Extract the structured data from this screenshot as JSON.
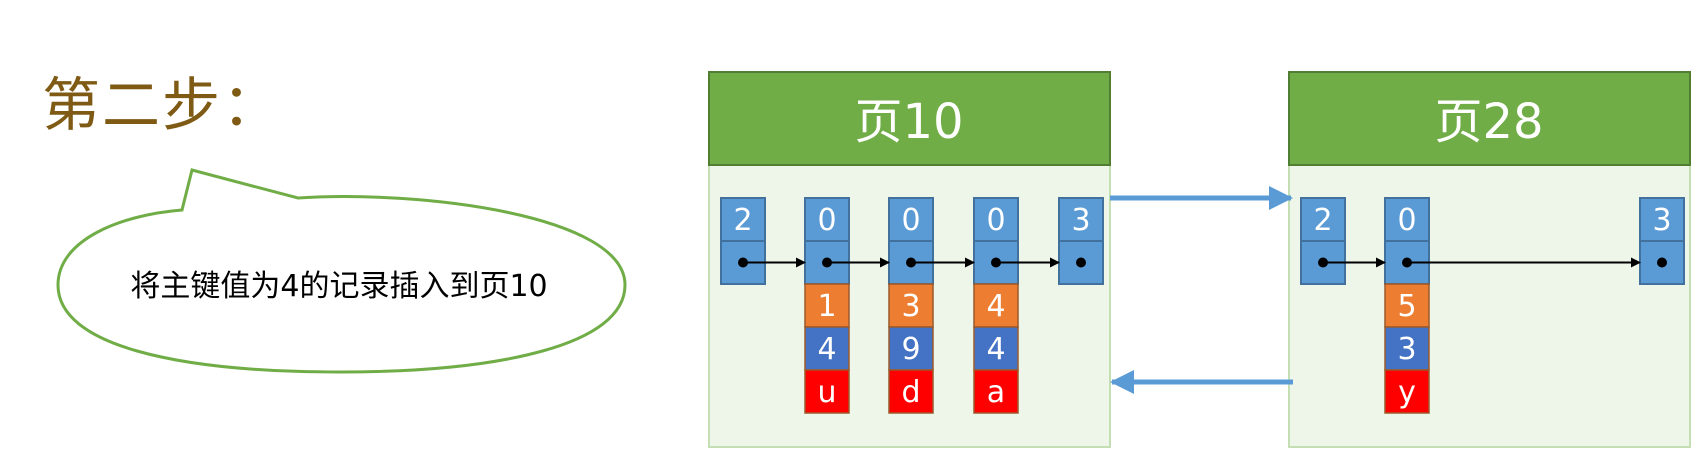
{
  "step_title": "第二步：",
  "callout": {
    "text": "将主键值为4的记录插入到页10"
  },
  "colors": {
    "page_header": "#70ad47",
    "page_header_border": "#507e32",
    "page_body": "#eef5e9",
    "page_body_border": "#c5dfb4",
    "header_cell": "#5b9bd5",
    "header_cell_border": "#41719c",
    "orange": "#ed7d31",
    "blue": "#4472c4",
    "red": "#ff0000",
    "link_arrow": "#5b9bd5",
    "title": "#7f5a14",
    "callout_border": "#70ad47"
  },
  "pages": [
    {
      "title": "页10",
      "records": [
        {
          "n_owned": "2",
          "data": []
        },
        {
          "n_owned": "0",
          "data": [
            "1",
            "4",
            "u"
          ]
        },
        {
          "n_owned": "0",
          "data": [
            "3",
            "9",
            "d"
          ]
        },
        {
          "n_owned": "0",
          "data": [
            "4",
            "4",
            "a"
          ]
        },
        {
          "n_owned": "3",
          "data": []
        }
      ]
    },
    {
      "title": "页28",
      "records": [
        {
          "n_owned": "2",
          "data": []
        },
        {
          "n_owned": "0",
          "data": [
            "5",
            "3",
            "y"
          ]
        },
        {
          "n_owned": "3",
          "data": []
        }
      ]
    }
  ]
}
